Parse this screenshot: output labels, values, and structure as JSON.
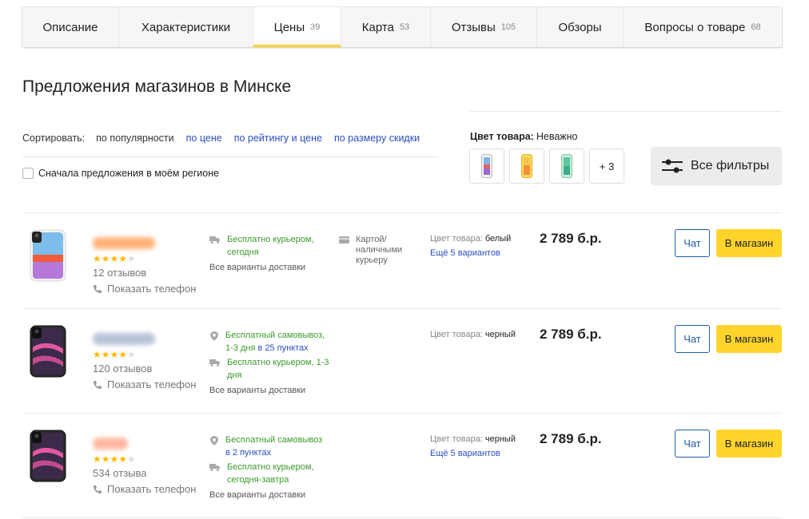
{
  "colors": {
    "accent": "#fed42b",
    "link": "#2a4ec1",
    "green": "#3c9a2c",
    "chat_border": "#1e5baa",
    "star": "#fdb900"
  },
  "tabs": [
    {
      "label": "Описание",
      "count": ""
    },
    {
      "label": "Характеристики",
      "count": ""
    },
    {
      "label": "Цены",
      "count": "39",
      "active": true
    },
    {
      "label": "Карта",
      "count": "53"
    },
    {
      "label": "Отзывы",
      "count": "105"
    },
    {
      "label": "Обзоры",
      "count": ""
    },
    {
      "label": "Вопросы о товаре",
      "count": "68"
    }
  ],
  "section_title": "Предложения магазинов в Минске",
  "sort": {
    "label": "Сортировать:",
    "options": [
      "по популярности",
      "по цене",
      "по рейтингу и цене",
      "по размеру скидки"
    ]
  },
  "region_checkbox_label": "Сначала предложения в моём регионе",
  "color_filter": {
    "label": "Цвет товара:",
    "value": "Неважно",
    "swatches": [
      "white-phone-icon",
      "yellow-phone-icon",
      "green-phone-icon"
    ],
    "more": "+ 3"
  },
  "all_filters_label": "Все фильтры",
  "offers": [
    {
      "phone_color": "white",
      "rating": 4,
      "reviews": "12 отзывов",
      "show_phone": "Показать телефон",
      "delivery": [
        {
          "icon": "truck-icon",
          "text": "Бесплатно курьером, сегодня",
          "extra": ""
        }
      ],
      "all_delivery": "Все варианты доставки",
      "payment": "Картой/ наличными курьеру",
      "color_label": "Цвет товара:",
      "color_value": "белый",
      "variants": "Ещё 5 вариантов",
      "price": "2 789 б.р.",
      "chat": "Чат",
      "to_shop": "В магазин"
    },
    {
      "phone_color": "black",
      "rating": 4,
      "reviews": "120 отзывов",
      "show_phone": "Показать телефон",
      "delivery": [
        {
          "icon": "pin-icon",
          "text": "Бесплатный самовывоз,",
          "extra_gray": "1-3 дня",
          "extra_link": "в 25 пунктах"
        },
        {
          "icon": "truck-icon",
          "text": "Бесплатно курьером, 1-3 дня",
          "extra": ""
        }
      ],
      "all_delivery": "Все варианты доставки",
      "payment": "",
      "color_label": "Цвет товара:",
      "color_value": "черный",
      "variants": "",
      "price": "2 789 б.р.",
      "chat": "Чат",
      "to_shop": "В магазин"
    },
    {
      "phone_color": "black",
      "rating": 4,
      "reviews": "534 отзыва",
      "show_phone": "Показать телефон",
      "delivery": [
        {
          "icon": "pin-icon",
          "text": "Бесплатный самовывоз",
          "extra_link": "в 2 пунктах"
        },
        {
          "icon": "truck-icon",
          "text": "Бесплатно курьером,",
          "extra_gray": "сегодня-завтра"
        }
      ],
      "all_delivery": "Все варианты доставки",
      "payment": "",
      "color_label": "Цвет товара:",
      "color_value": "черный",
      "variants": "Ещё 5 вариантов",
      "price": "2 789 б.р.",
      "chat": "Чат",
      "to_shop": "В магазин"
    }
  ]
}
